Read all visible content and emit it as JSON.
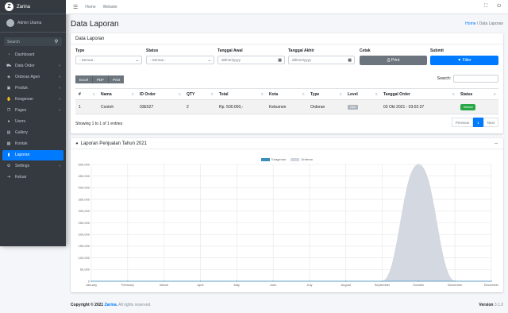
{
  "brand": {
    "name": "Zarina"
  },
  "user": {
    "name": "Admin Utama"
  },
  "sidebar": {
    "search_placeholder": "Search",
    "items": [
      {
        "label": "Dashboard",
        "icon": "tachometer-icon",
        "arrow": false,
        "active": false
      },
      {
        "label": "Data Order",
        "icon": "cart-icon",
        "arrow": true,
        "active": false
      },
      {
        "label": "Orderan Agen",
        "icon": "shopping-bag-icon",
        "arrow": true,
        "active": false
      },
      {
        "label": "Produk",
        "icon": "box-icon",
        "arrow": true,
        "active": false
      },
      {
        "label": "Keagenan",
        "icon": "handshake-icon",
        "arrow": true,
        "active": false
      },
      {
        "label": "Pages",
        "icon": "copy-icon",
        "arrow": true,
        "active": false
      },
      {
        "label": "Users",
        "icon": "user-icon",
        "arrow": false,
        "active": false
      },
      {
        "label": "Gallery",
        "icon": "image-icon",
        "arrow": false,
        "active": false
      },
      {
        "label": "Kontak",
        "icon": "contact-icon",
        "arrow": false,
        "active": false
      },
      {
        "label": "Laporan",
        "icon": "file-icon",
        "arrow": false,
        "active": true
      },
      {
        "label": "Settings",
        "icon": "gear-icon",
        "arrow": true,
        "active": false
      },
      {
        "label": "Keluar",
        "icon": "sign-out-icon",
        "arrow": false,
        "active": false
      }
    ]
  },
  "topbar": {
    "home": "Home",
    "website": "Website"
  },
  "page": {
    "title": "Data Laporan",
    "crumb_home": "Home",
    "crumb_sep": "/",
    "crumb_current": "Data Laporan"
  },
  "card": {
    "title": "Data Laporan"
  },
  "filters": {
    "type_label": "Type",
    "type_value": "- Semua -",
    "status_label": "Status",
    "status_value": "- Semua -",
    "start_label": "Tanggal Awal",
    "start_placeholder": "dd/mm/yyyy",
    "end_label": "Tanggal Akhir",
    "end_placeholder": "dd/mm/yyyy",
    "print_label": "Cetak",
    "print_button": "Print",
    "submit_label": "Submit",
    "submit_button": "Filter"
  },
  "export": {
    "excel": "Excel",
    "pdf": "PDF",
    "print": "Print"
  },
  "search_label": "Search:",
  "table": {
    "headers": [
      "#",
      "Nama",
      "ID Order",
      "QTY",
      "Total",
      "Kota",
      "Type",
      "Level",
      "Tanggal Order",
      "Status"
    ],
    "rows": [
      {
        "no": "1",
        "nama": "Contoh",
        "id": "03E527",
        "qty": "2",
        "total": "Rp. 500.000,-",
        "kota": "Kebumen",
        "type": "Orderan",
        "level": "User",
        "tanggal": "03 Okt 2021 - 03:02:37",
        "status": "Selesai"
      }
    ]
  },
  "info": "Showing 1 to 1 of 1 entries",
  "pager": {
    "prev": "Previous",
    "page": "1",
    "next": "Next"
  },
  "chart_card": {
    "title": "Laporan Penjualan Tahun 2021",
    "collapse": "–"
  },
  "chart_data": {
    "type": "area",
    "title": "",
    "categories": [
      "January",
      "February",
      "March",
      "April",
      "May",
      "June",
      "July",
      "August",
      "September",
      "October",
      "November",
      "December"
    ],
    "ylim": [
      0,
      500000
    ],
    "yticks": [
      0,
      50000,
      100000,
      150000,
      200000,
      250000,
      300000,
      350000,
      400000,
      450000,
      500000
    ],
    "ytick_labels": [
      "0",
      "50,000",
      "100,000",
      "150,000",
      "200,000",
      "250,000",
      "300,000",
      "350,000",
      "400,000",
      "450,000",
      "500,000"
    ],
    "grid": true,
    "legend": "top",
    "series": [
      {
        "name": "Keagenan",
        "color": "#3c8dbc",
        "values": [
          0,
          0,
          0,
          0,
          0,
          0,
          0,
          0,
          0,
          0,
          0,
          0
        ]
      },
      {
        "name": "Orderan",
        "color": "#d2d6de",
        "values": [
          0,
          0,
          0,
          0,
          0,
          0,
          0,
          0,
          0,
          500000,
          0,
          0
        ]
      }
    ]
  },
  "footer": {
    "copyright": "Copyright © 2021",
    "brand": "Zarina.",
    "rights": "All rights reserved.",
    "version_label": "Version",
    "version": "3.1.0"
  }
}
